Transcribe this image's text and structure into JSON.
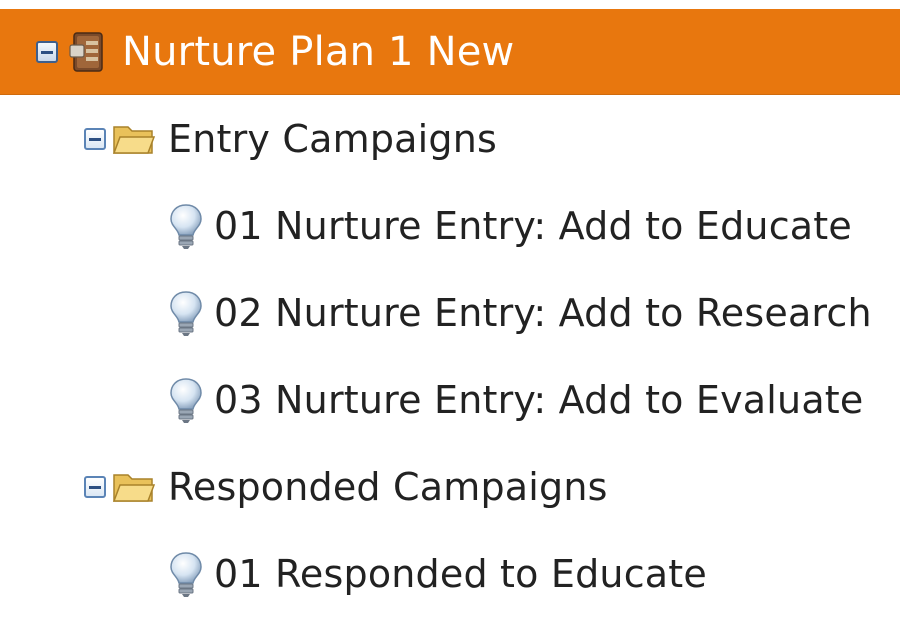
{
  "tree": {
    "root": {
      "label": "Nurture Plan 1 New",
      "icon": "program-icon",
      "expanded": true,
      "selected": true,
      "highlight_color": "#e8770e"
    },
    "folders": [
      {
        "label": "Entry Campaigns",
        "icon": "folder-open-icon",
        "expanded": true,
        "items": [
          {
            "label": "01 Nurture Entry: Add to Educate",
            "icon": "lightbulb-icon"
          },
          {
            "label": "02 Nurture Entry: Add to Research",
            "icon": "lightbulb-icon"
          },
          {
            "label": "03 Nurture Entry: Add to Evaluate",
            "icon": "lightbulb-icon"
          }
        ]
      },
      {
        "label": "Responded Campaigns",
        "icon": "folder-open-icon",
        "expanded": true,
        "items": [
          {
            "label": "01 Responded to Educate",
            "icon": "lightbulb-icon"
          }
        ]
      }
    ]
  }
}
